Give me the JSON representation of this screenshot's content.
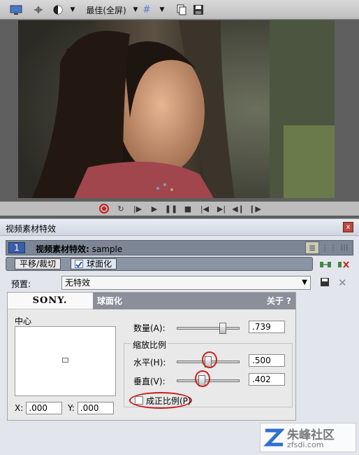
{
  "toolbar": {
    "quality_label": "最佳(全屏)"
  },
  "transport": {
    "buttons": [
      "record",
      "loop",
      "play-from-start",
      "play",
      "pause",
      "stop",
      "prev-frame",
      "next-frame",
      "prev-marker",
      "next-marker"
    ]
  },
  "dialog": {
    "title": "视频素材特效",
    "close": "x",
    "chain": {
      "badge": "1",
      "label_prefix": "视频素材特效:",
      "clip_name": "sample"
    },
    "tabs": [
      {
        "label": "平移/裁切",
        "active": false
      },
      {
        "label": "球面化",
        "active": true
      }
    ],
    "preset": {
      "label": "预置:",
      "value": "无特效"
    },
    "plugin": {
      "brand": "SONY.",
      "title": "球面化",
      "about": "关于 ?",
      "center_label": "中心",
      "x_label": "X:",
      "x_value": ".000",
      "y_label": "Y:",
      "y_value": ".000",
      "amount_label": "数量(A):",
      "amount_value": ".739",
      "amount_fraction": 0.739,
      "scale_group_label": "缩放比例",
      "horizontal_label": "水平(H):",
      "horizontal_value": ".500",
      "horizontal_fraction": 0.5,
      "vertical_label": "垂直(V):",
      "vertical_value": ".402",
      "vertical_fraction": 0.402,
      "proportional_label": "成正比例(P)",
      "proportional_checked": false
    }
  },
  "watermark": {
    "text": "朱峰社区",
    "url": "zfsdi.com"
  },
  "colors": {
    "highlight": "#c81e1e",
    "accent": "#3a5ea8"
  }
}
